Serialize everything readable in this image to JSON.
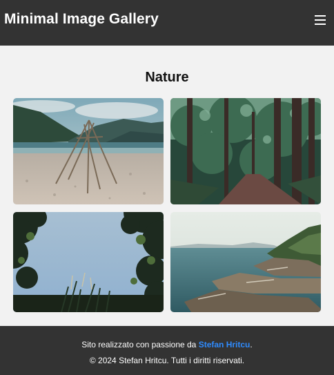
{
  "header": {
    "title": "Minimal Image Gallery",
    "menu_icon": "hamburger-menu-icon"
  },
  "gallery": {
    "title": "Nature",
    "images": [
      {
        "subject": "teepee of sticks on lake beach with mountains"
      },
      {
        "subject": "forest path with tall trees"
      },
      {
        "subject": "looking up at sky through leaves and grass"
      },
      {
        "subject": "rocky coastline with sea"
      }
    ]
  },
  "footer": {
    "credit_prefix": "Sito realizzato con passione da",
    "author_name": "Stefan Hritcu",
    "credit_suffix": ".",
    "copyright": "© 2024 Stefan Hritcu. Tutti i diritti riservati."
  },
  "colors": {
    "header_bg": "#333333",
    "page_bg": "#f2f2f2",
    "link": "#2f8cff"
  }
}
